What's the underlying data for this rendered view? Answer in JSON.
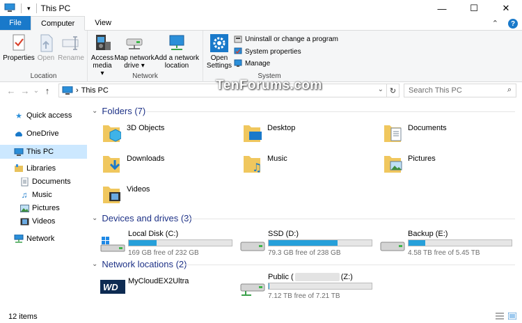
{
  "window": {
    "title": "This PC",
    "minimize": "—",
    "maximize": "☐",
    "close": "✕"
  },
  "ribbon_tabs": {
    "file": "File",
    "computer": "Computer",
    "view": "View",
    "collapse": "⌃",
    "help": "?"
  },
  "ribbon": {
    "location": {
      "label": "Location",
      "properties": "Properties",
      "open": "Open",
      "rename": "Rename"
    },
    "network": {
      "label": "Network",
      "access_media": "Access media ▾",
      "map_network_drive": "Map network drive ▾",
      "add_network_location": "Add a network location"
    },
    "system": {
      "label": "System",
      "open_settings": "Open Settings",
      "uninstall": "Uninstall or change a program",
      "system_properties": "System properties",
      "manage": "Manage"
    }
  },
  "address": {
    "back": "←",
    "forward": "→",
    "recent": "⌄",
    "up": "↑",
    "path_sep": "›",
    "path": "This PC",
    "dropdown": "⌄",
    "refresh": "↻"
  },
  "search": {
    "placeholder": "Search This PC",
    "icon": "⌕"
  },
  "watermark": "TenForums.com",
  "nav": {
    "quick_access": "Quick access",
    "onedrive": "OneDrive",
    "this_pc": "This PC",
    "libraries": "Libraries",
    "documents": "Documents",
    "music": "Music",
    "pictures": "Pictures",
    "videos": "Videos",
    "network": "Network"
  },
  "folders": {
    "header": "Folders (7)",
    "items": [
      "3D Objects",
      "Desktop",
      "Documents",
      "Downloads",
      "Music",
      "Pictures",
      "Videos"
    ]
  },
  "devices": {
    "header": "Devices and drives (3)",
    "drives": [
      {
        "name": "Local Disk (C:)",
        "free": "169 GB free of 232 GB",
        "used_fraction": 0.27
      },
      {
        "name": "SSD (D:)",
        "free": "79.3 GB free of 238 GB",
        "used_fraction": 0.67
      },
      {
        "name": "Backup (E:)",
        "free": "4.58 TB free of 5.45 TB",
        "used_fraction": 0.16
      }
    ]
  },
  "network_locations": {
    "header": "Network locations (2)",
    "mycloud": "MyCloudEX2Ultra",
    "public_prefix": "Public (",
    "public_suffix": "(Z:)",
    "public_free": "7.12 TB free of 7.21 TB",
    "public_used_fraction": 0.01
  },
  "status": {
    "items": "12 items"
  },
  "colors": {
    "accent": "#1979ca",
    "selection": "#cce8ff",
    "drive_bar": "#26a0da",
    "section_header": "#1e3287"
  }
}
